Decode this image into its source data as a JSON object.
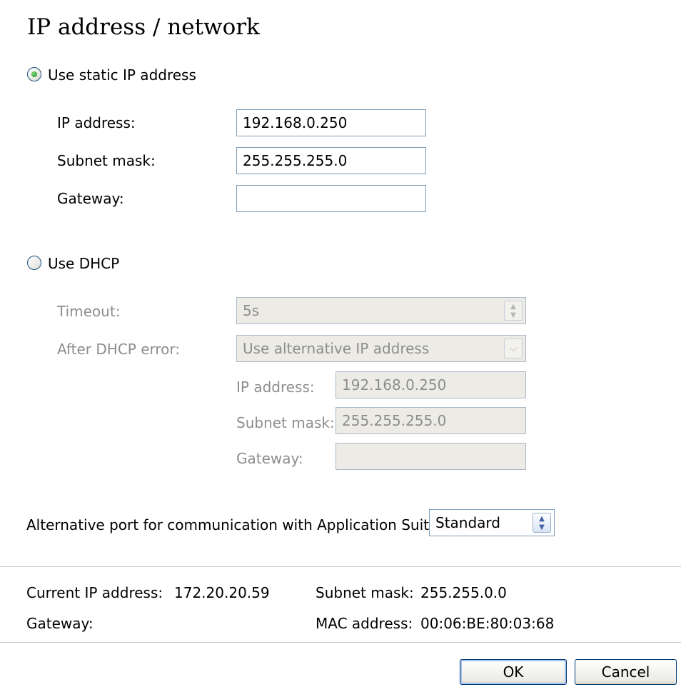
{
  "title": "IP address / network",
  "static": {
    "radio_label": "Use static IP address",
    "selected": true,
    "ip_label": "IP address:",
    "ip_value": "192.168.0.250",
    "mask_label": "Subnet mask:",
    "mask_value": "255.255.255.0",
    "gateway_label": "Gateway:",
    "gateway_value": ""
  },
  "dhcp": {
    "radio_label": "Use DHCP",
    "selected": false,
    "timeout_label": "Timeout:",
    "timeout_value": "5s",
    "error_label": "After DHCP error:",
    "error_value": "Use alternative IP address",
    "alt_ip_label": "IP address:",
    "alt_ip_value": "192.168.0.250",
    "alt_mask_label": "Subnet mask:",
    "alt_mask_value": "255.255.255.0",
    "alt_gateway_label": "Gateway:",
    "alt_gateway_value": ""
  },
  "port": {
    "label": "Alternative port for communication with Application Suite:",
    "value": "Standard"
  },
  "current": {
    "ip_label": "Current IP address:",
    "ip_value": "172.20.20.59",
    "mask_label": "Subnet mask:",
    "mask_value": "255.255.0.0",
    "gateway_label": "Gateway:",
    "gateway_value": "",
    "mac_label": "MAC address:",
    "mac_value": "00:06:BE:80:03:68"
  },
  "buttons": {
    "ok": "OK",
    "cancel": "Cancel"
  },
  "icons": {
    "spin": "spinner-arrows-icon",
    "dropdown": "chevron-down-icon",
    "radio": "radio-button-icon"
  },
  "colors": {
    "field_border": "#7f9db9",
    "disabled_bg": "#ecebe6",
    "disabled_text": "#8d8d8d",
    "button_border": "#003c74",
    "radio_dot": "#1f8a1f"
  }
}
